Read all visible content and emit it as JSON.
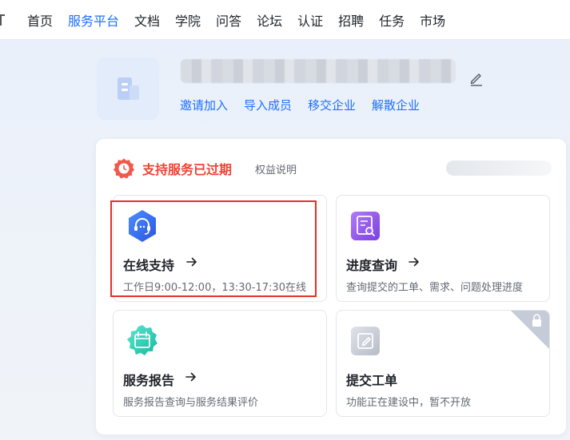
{
  "nav": {
    "items": [
      {
        "label": "首页",
        "active": false
      },
      {
        "label": "服务平台",
        "active": true
      },
      {
        "label": "文档",
        "active": false
      },
      {
        "label": "学院",
        "active": false
      },
      {
        "label": "问答",
        "active": false
      },
      {
        "label": "论坛",
        "active": false
      },
      {
        "label": "认证",
        "active": false
      },
      {
        "label": "招聘",
        "active": false
      },
      {
        "label": "任务",
        "active": false
      },
      {
        "label": "市场",
        "active": false
      }
    ]
  },
  "org": {
    "logo_icon": "building-icon",
    "edit_icon": "pencil-icon",
    "actions": [
      "邀请加入",
      "导入成员",
      "移交企业",
      "解散企业"
    ]
  },
  "service": {
    "status_title": "支持服务已过期",
    "status_icon": "clock-badge-icon",
    "rights_link": "权益说明",
    "tiles": [
      {
        "title": "在线支持",
        "desc": "工作日9:00-12:00，13:30-17:30在线",
        "icon": "headset-icon",
        "highlighted": true,
        "locked": false
      },
      {
        "title": "进度查询",
        "desc": "查询提交的工单、需求、问题处理进度",
        "icon": "document-search-icon",
        "highlighted": false,
        "locked": false
      },
      {
        "title": "服务报告",
        "desc": "服务报告查询与服务结果评价",
        "icon": "calendar-report-icon",
        "highlighted": false,
        "locked": false
      },
      {
        "title": "提交工单",
        "desc": "功能正在建设中，暂不开放",
        "icon": "edit-ticket-icon",
        "highlighted": false,
        "locked": true
      }
    ]
  },
  "colors": {
    "accent": "#1e6fff",
    "danger": "#f04134",
    "highlight": "#e0312a"
  }
}
